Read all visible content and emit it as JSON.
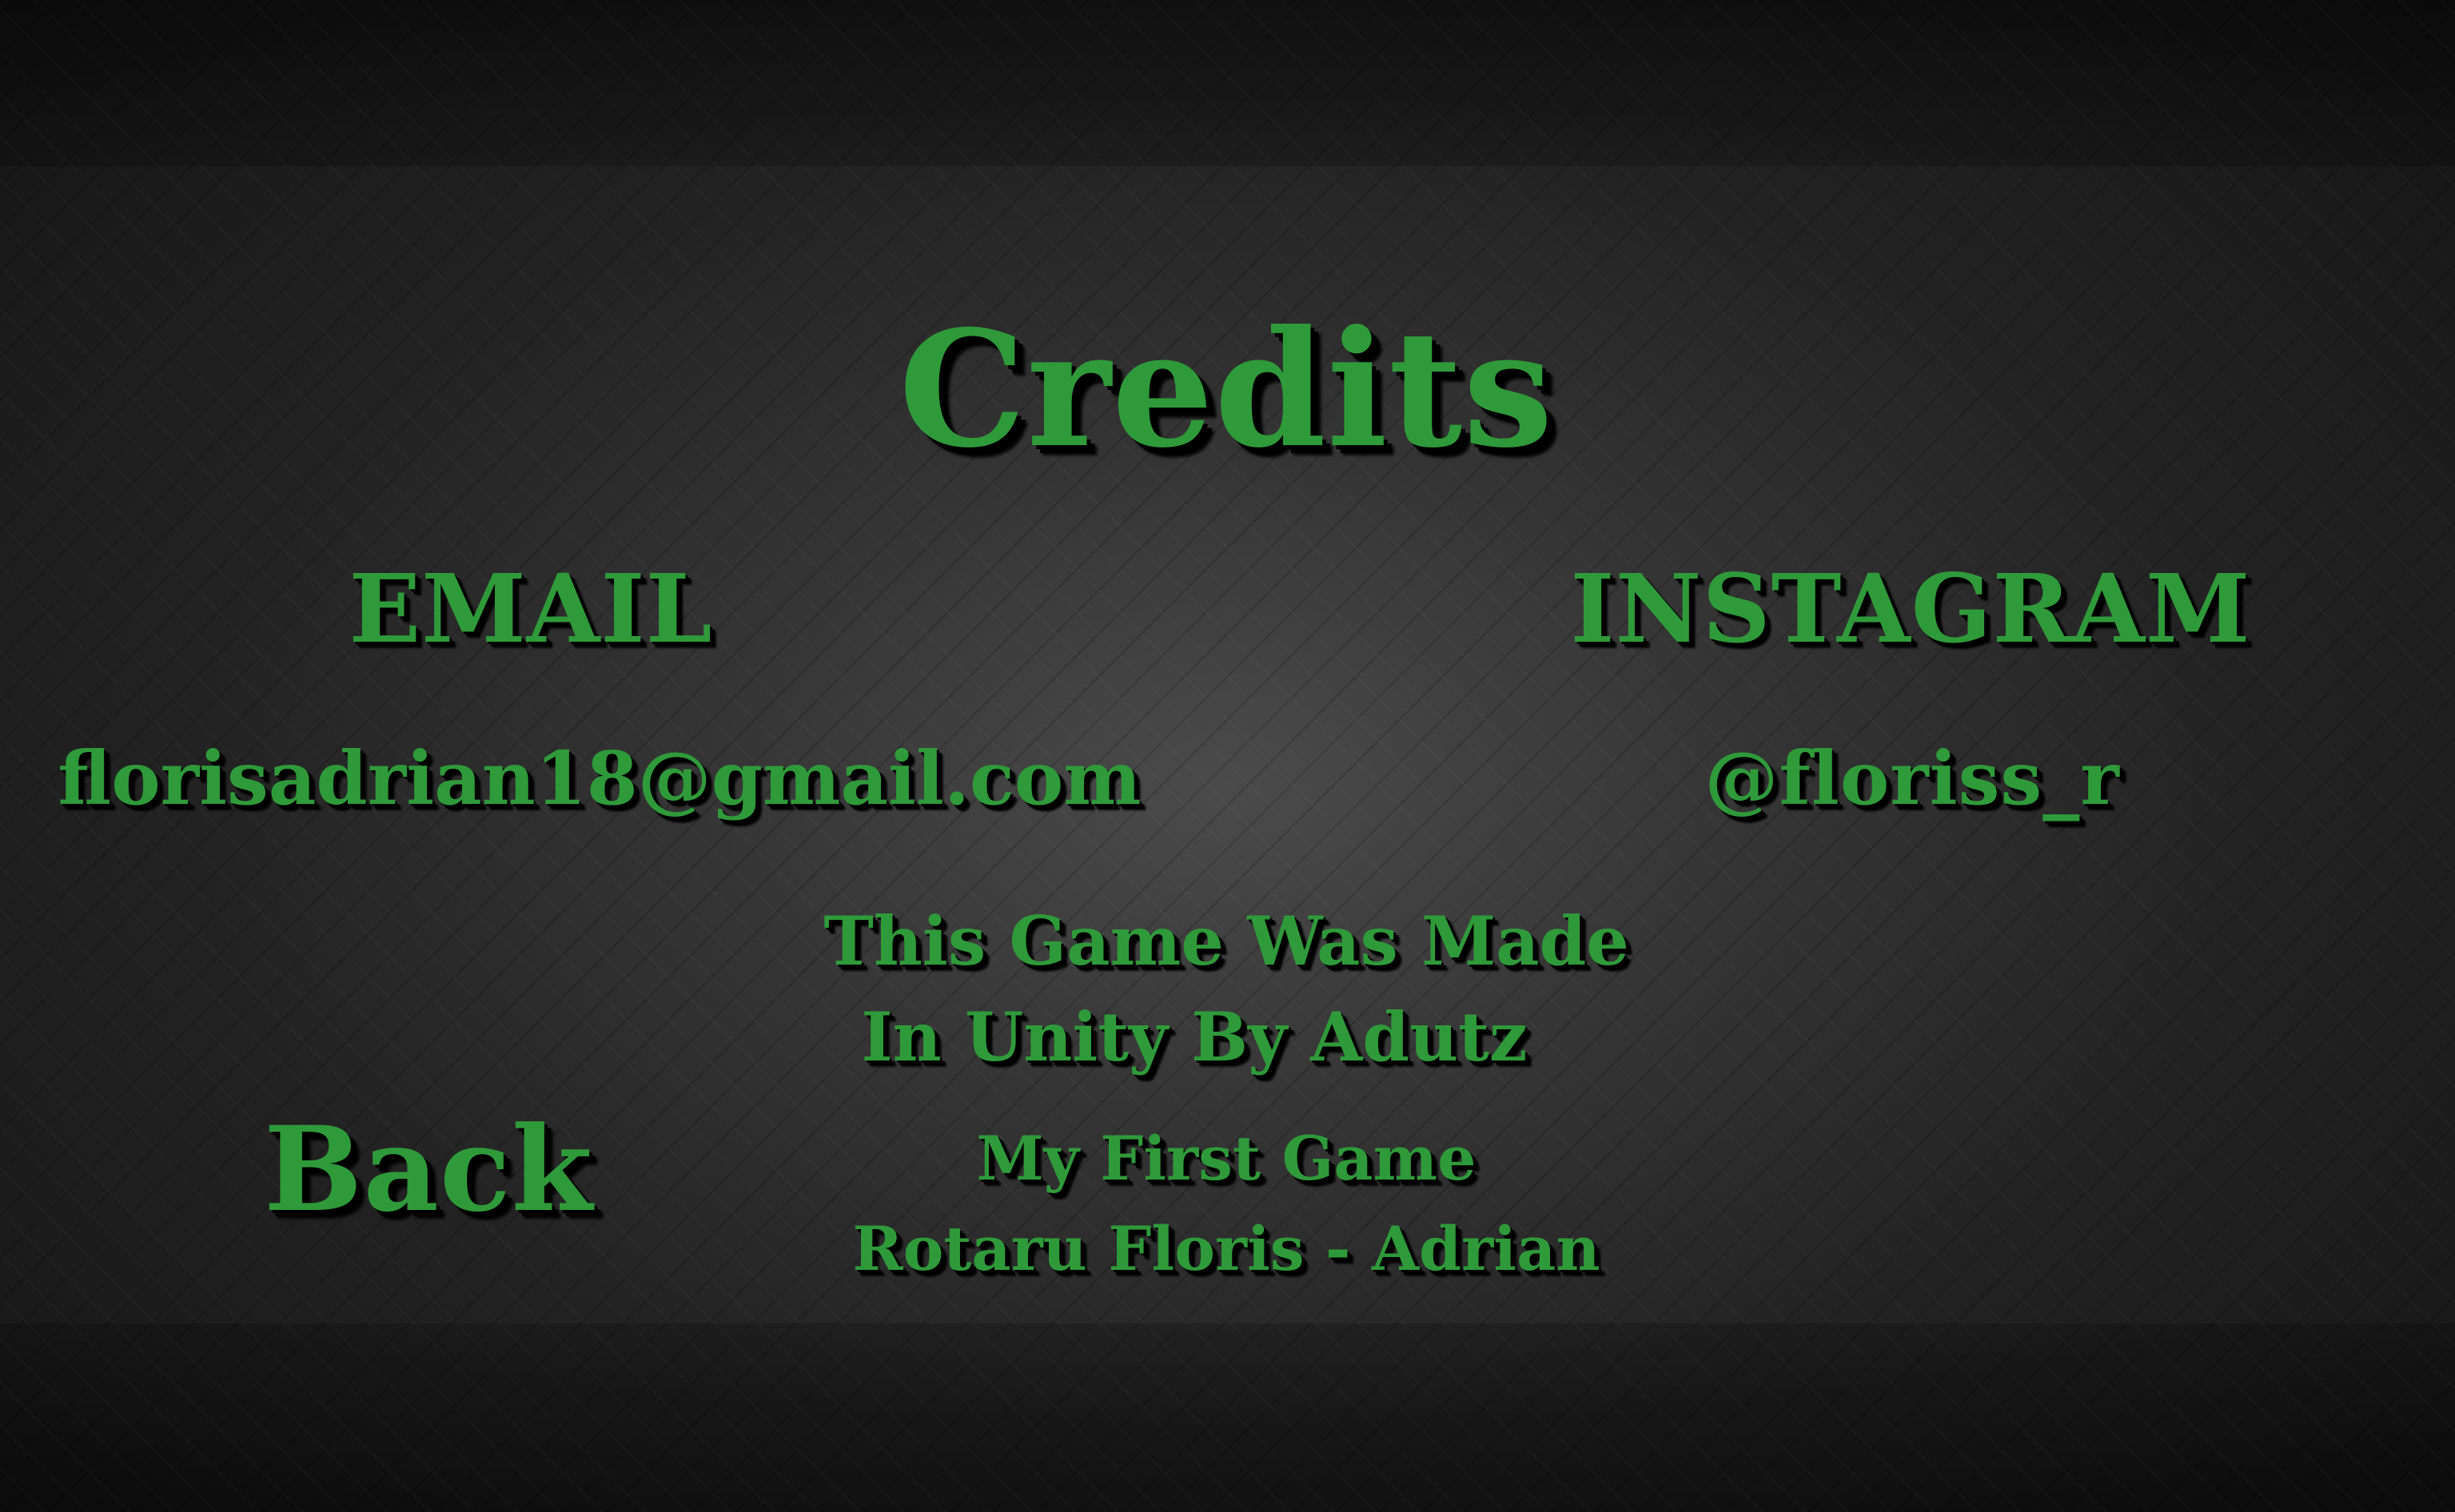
{
  "screen": {
    "title": "Credits",
    "email": {
      "heading": "EMAIL",
      "value": "florisadrian18@gmail.com"
    },
    "instagram": {
      "heading": "INSTAGRAM",
      "value": "@floriss_r"
    },
    "made_with": {
      "line1": "This Game Was Made",
      "line2": "In Unity By Adutz"
    },
    "back_label": "Back",
    "first_game": "My First Game",
    "author": "Rotaru Floris - Adrian"
  },
  "colors": {
    "text_green": "#2f9a3a",
    "shadow": "#000000",
    "background": "#2a2a2a"
  }
}
